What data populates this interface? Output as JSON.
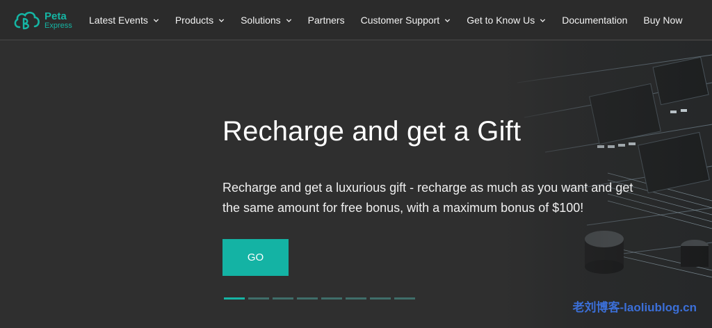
{
  "brand": {
    "name": "Peta",
    "sub": "Express",
    "color": "#15b5a4"
  },
  "nav": {
    "items": [
      {
        "label": "Latest Events",
        "has_dropdown": true
      },
      {
        "label": "Products",
        "has_dropdown": true
      },
      {
        "label": "Solutions",
        "has_dropdown": true
      },
      {
        "label": "Partners",
        "has_dropdown": false
      },
      {
        "label": "Customer Support",
        "has_dropdown": true
      },
      {
        "label": "Get to Know Us",
        "has_dropdown": true
      },
      {
        "label": "Documentation",
        "has_dropdown": false
      },
      {
        "label": "Buy Now",
        "has_dropdown": false
      }
    ]
  },
  "hero": {
    "title": "Recharge and get a Gift",
    "description": "Recharge and get a luxurious gift - recharge as much as you want and get the same amount for free bonus, with a maximum bonus of $100!",
    "button_label": "GO",
    "accent": "#14b3a4"
  },
  "carousel": {
    "slide_count": 8,
    "active_index": 0
  },
  "watermark": "老刘博客-laoliublog.cn"
}
